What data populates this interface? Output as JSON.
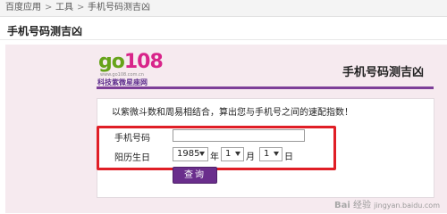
{
  "breadcrumb": {
    "items": [
      "百度应用",
      "工具",
      "手机号码测吉凶"
    ],
    "separator": ">"
  },
  "page_heading": "手机号码测吉凶",
  "logo": {
    "text_go": "go",
    "text_num": "108",
    "site": "www.go108.com.cn",
    "tagline": "科技紫微星座网"
  },
  "app_title": "手机号码测吉凶",
  "intro": "以紫微斗数和周易相结合，算出您与手机号之间的速配指数！",
  "form": {
    "phone_label": "手机号码",
    "phone_value": "",
    "birth_label": "阳历生日",
    "year_value": "1985",
    "year_unit": "年",
    "month_value": "1",
    "month_unit": "月",
    "day_value": "1",
    "day_unit": "日",
    "submit_label": "查询"
  },
  "watermark": {
    "logo": "Bai",
    "text": "经验",
    "url": "jingyan.baidu.com"
  },
  "colors": {
    "accent_purple": "#6a2e8c",
    "highlight_red": "#e01e26",
    "panel_bg": "#f6eaef",
    "logo_green": "#66a31a",
    "logo_pink": "#d8248a"
  }
}
